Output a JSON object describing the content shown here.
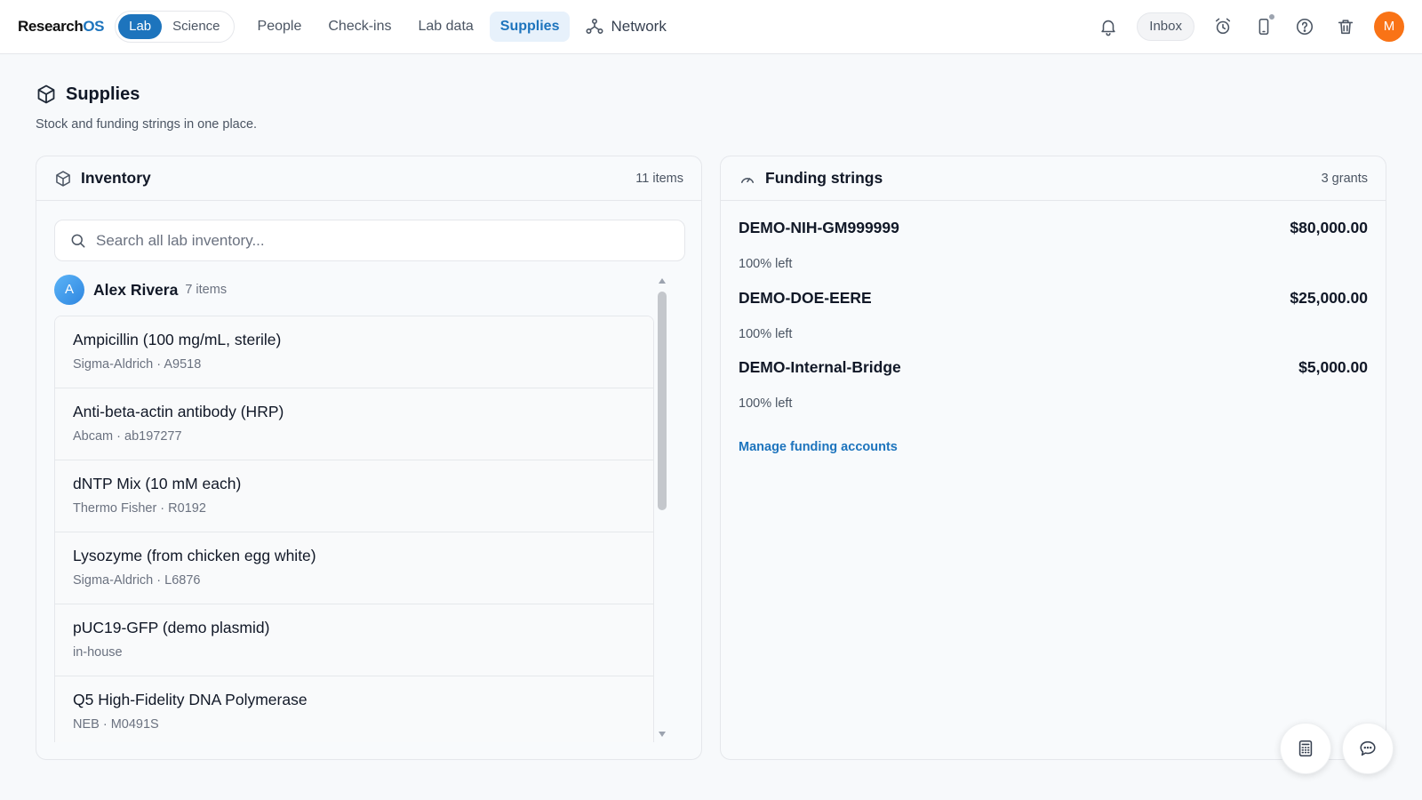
{
  "app": {
    "name_part1": "Research",
    "name_part2": "OS"
  },
  "nav": {
    "toggle": [
      "Lab",
      "Science"
    ],
    "links": [
      "People",
      "Check-ins",
      "Lab data",
      "Supplies"
    ],
    "network_label": "Network",
    "inbox_label": "Inbox",
    "user_initial": "M"
  },
  "page": {
    "title": "Supplies",
    "subtitle": "Stock and funding strings in one place."
  },
  "inventory": {
    "title": "Inventory",
    "count": "11 items",
    "search_placeholder": "Search all lab inventory...",
    "owner": {
      "initial": "A",
      "name": "Alex Rivera",
      "count": "7 items"
    },
    "items": [
      {
        "name": "Ampicillin (100 mg/mL, sterile)",
        "meta": "Sigma-Aldrich · A9518"
      },
      {
        "name": "Anti-beta-actin antibody (HRP)",
        "meta": "Abcam · ab197277"
      },
      {
        "name": "dNTP Mix (10 mM each)",
        "meta": "Thermo Fisher · R0192"
      },
      {
        "name": "Lysozyme (from chicken egg white)",
        "meta": "Sigma-Aldrich · L6876"
      },
      {
        "name": "pUC19-GFP (demo plasmid)",
        "meta": "in-house"
      },
      {
        "name": "Q5 High-Fidelity DNA Polymerase",
        "meta": "NEB · M0491S"
      }
    ]
  },
  "funding": {
    "title": "Funding strings",
    "count": "3 grants",
    "grants": [
      {
        "name": "DEMO-NIH-GM999999",
        "amount": "$80,000.00",
        "left": "100% left"
      },
      {
        "name": "DEMO-DOE-EERE",
        "amount": "$25,000.00",
        "left": "100% left"
      },
      {
        "name": "DEMO-Internal-Bridge",
        "amount": "$5,000.00",
        "left": "100% left"
      }
    ],
    "manage_label": "Manage funding accounts"
  },
  "icons": {
    "page": "cube-icon",
    "inventory": "cube-icon",
    "funding": "gauge-icon",
    "search": "search-icon",
    "notifications": "bell-icon",
    "alarm": "alarm-clock-icon",
    "device": "phone-icon",
    "help": "help-icon",
    "trash": "trash-icon",
    "network": "network-icon",
    "calculator": "calculator-icon",
    "chat": "chat-icon"
  },
  "colors": {
    "accent": "#1d74bd",
    "avatar_user": "#f97316",
    "avatar_owner": "#3b8fe6"
  }
}
